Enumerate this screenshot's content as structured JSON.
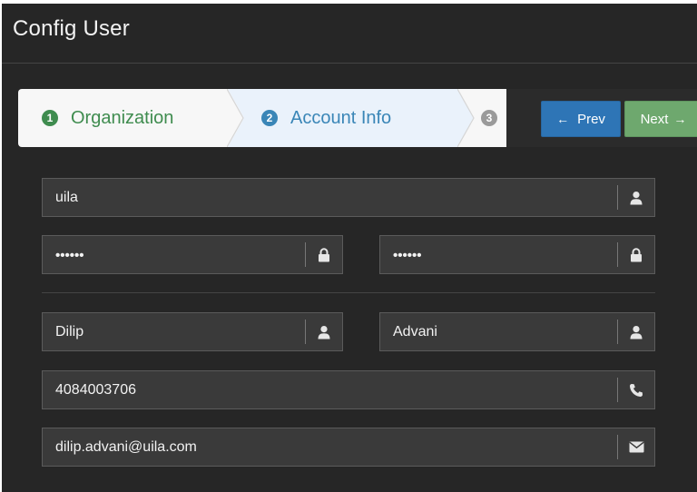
{
  "window": {
    "title": "Config User"
  },
  "wizard": {
    "steps": [
      {
        "number": "1",
        "label": "Organization",
        "state": "complete",
        "color": "#3f8c4f"
      },
      {
        "number": "2",
        "label": "Account Info",
        "state": "active",
        "color": "#3a86b7"
      },
      {
        "number": "3",
        "label": "",
        "state": "pending",
        "color": "#9a9a9a"
      }
    ],
    "prev_label": "Prev",
    "next_label": "Next",
    "prev_icon": "arrow-left-icon",
    "next_icon": "arrow-right-icon"
  },
  "form": {
    "username": {
      "value": "uila",
      "icon": "user-icon"
    },
    "password": {
      "value": "••••••",
      "icon": "lock-icon"
    },
    "confirm_password": {
      "value": "••••••",
      "icon": "lock-icon"
    },
    "first_name": {
      "value": "Dilip",
      "icon": "user-icon"
    },
    "last_name": {
      "value": "Advani",
      "icon": "user-icon"
    },
    "phone": {
      "value": "4084003706",
      "icon": "phone-icon"
    },
    "email": {
      "value": "dilip.advani@uila.com",
      "icon": "envelope-icon"
    }
  },
  "colors": {
    "background": "#262626",
    "field_bg": "#3a3a3a",
    "prev_button": "#2e75b6",
    "next_button": "#6ea86e"
  }
}
